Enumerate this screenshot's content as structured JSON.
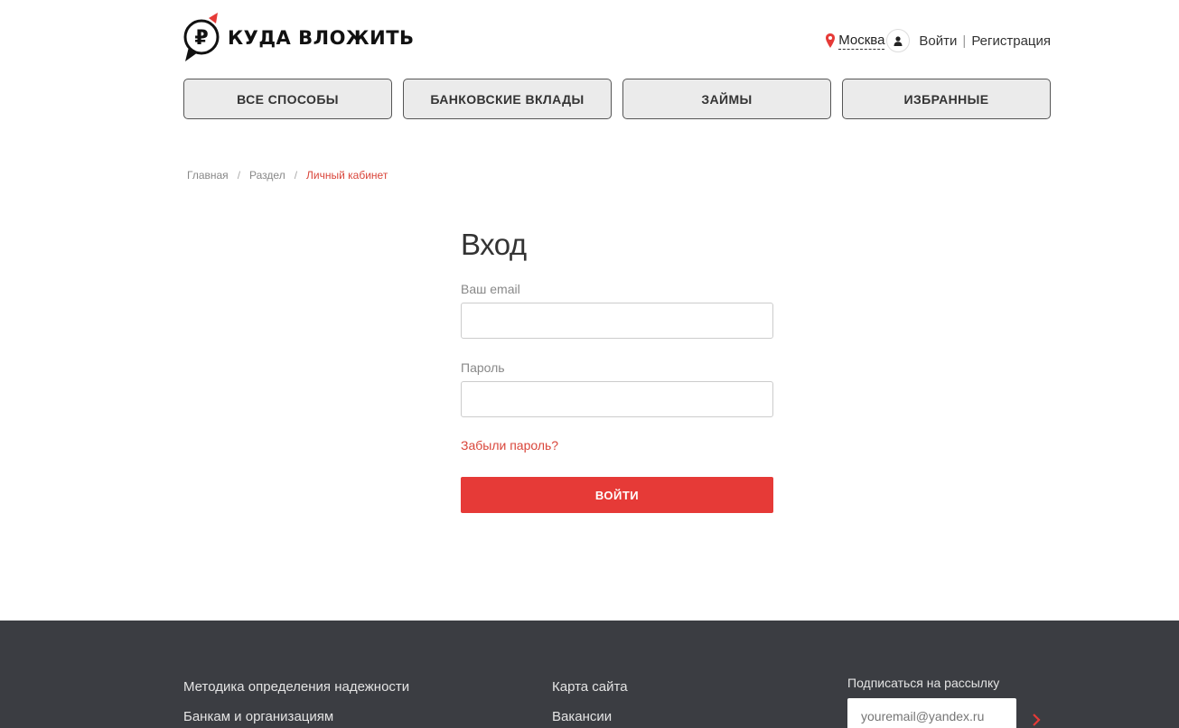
{
  "header": {
    "logo_text": "КУДА ВЛОЖИТЬ",
    "city": "Москва",
    "login_link": "Войти",
    "separator": "|",
    "register_link": "Регистрация"
  },
  "nav": {
    "items": [
      {
        "label": "ВСЕ СПОСОБЫ"
      },
      {
        "label": "БАНКОВСКИЕ ВКЛАДЫ"
      },
      {
        "label": "ЗАЙМЫ"
      },
      {
        "label": "ИЗБРАННЫЕ"
      }
    ]
  },
  "breadcrumb": {
    "items": [
      "Главная",
      "Раздел"
    ],
    "separator": "/",
    "current": "Личный кабинет"
  },
  "login": {
    "title": "Вход",
    "email_label": "Ваш email",
    "email_value": "",
    "password_label": "Пароль",
    "password_value": "",
    "forgot_label": "Забыли пароль?",
    "submit_label": "ВОЙТИ"
  },
  "footer": {
    "col1": [
      "Методика определения надежности",
      "Банкам и организациям"
    ],
    "col2": [
      "Карта сайта",
      "Вакансии"
    ],
    "subscribe_label": "Подписаться на рассылку",
    "subscribe_placeholder": "youremail@yandex.ru"
  },
  "colors": {
    "accent": "#e63a37",
    "footer_bg": "#3b3d42",
    "nav_bg": "#ebebeb"
  }
}
